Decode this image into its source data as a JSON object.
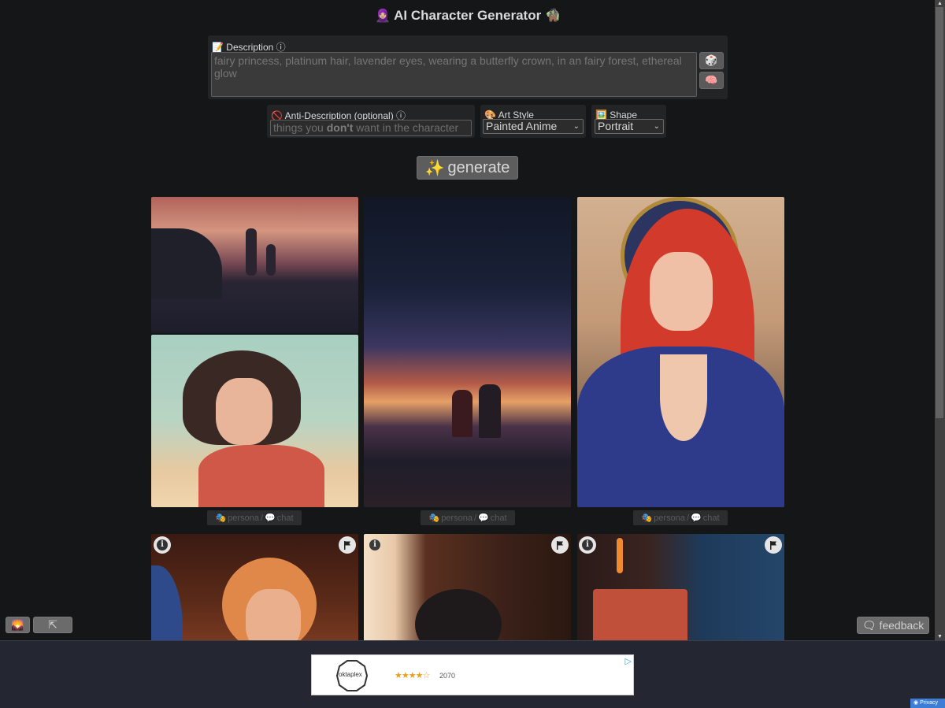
{
  "header": {
    "title": "AI Character Generator",
    "left_emoji": "🧕🏼",
    "right_emoji": "🧌"
  },
  "description": {
    "label_icon": "📝",
    "label": "Description",
    "info_icon": "ⓘ",
    "placeholder": "fairy princess, platinum hair, lavender eyes, wearing a butterfly crown, in an fairy forest, ethereal glow",
    "value": "",
    "random_button_icon": "🎲",
    "brain_button_icon": "🧠"
  },
  "anti_description": {
    "label_icon": "🚫",
    "label": "Anti-Description (optional)",
    "info_icon": "ⓘ",
    "placeholder_pre": "things you ",
    "placeholder_bold": "don't",
    "placeholder_post": " want in the character"
  },
  "art_style": {
    "label_icon": "🎨",
    "label": "Art Style",
    "selected": "Painted Anime"
  },
  "shape": {
    "label_icon": "🖼️",
    "label": "Shape",
    "selected": "Portrait"
  },
  "generate": {
    "icon": "✨",
    "label": "generate"
  },
  "results": [
    {
      "persona_icon": "🎭",
      "persona": "persona",
      "sep": " / ",
      "chat_icon": "💬",
      "chat": "chat"
    },
    {
      "persona_icon": "🎭",
      "persona": "persona",
      "sep": " / ",
      "chat_icon": "💬",
      "chat": "chat"
    },
    {
      "persona_icon": "🎭",
      "persona": "persona",
      "sep": " / ",
      "chat_icon": "💬",
      "chat": "chat"
    }
  ],
  "image_controls": {
    "info_glyph": "i"
  },
  "floating": {
    "gallery_icon": "🌄",
    "collapse_icon": "⇱",
    "feedback_icon": "🗨",
    "feedback_label": "feedback"
  },
  "ad": {
    "brand": "oktaplex",
    "rating_stars": 4,
    "rating_max": 5,
    "review_count": "2070",
    "privacy_label": "Privacy"
  },
  "colors": {
    "page_bg": "#151618",
    "panel_bg": "#232426",
    "button_bg": "#5d5d5d",
    "ad_bar_bg": "#242731",
    "privacy_bg": "#3d7dd6"
  }
}
